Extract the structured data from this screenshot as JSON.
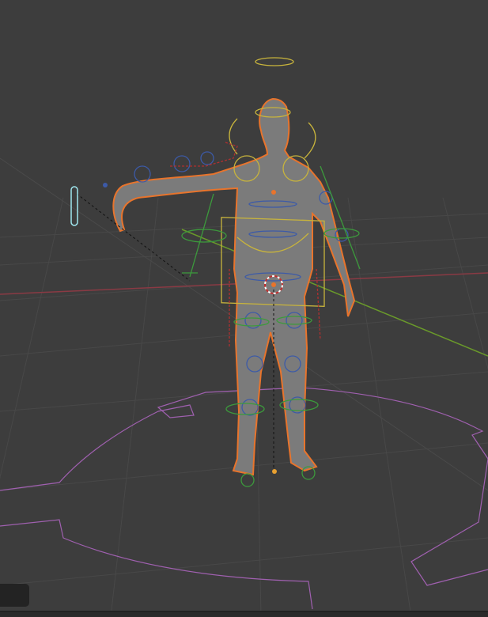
{
  "viewport": {
    "background": "#3d3d3d",
    "grid_color": "#4a4a4a",
    "x_axis_color": "#8a3a44",
    "y_axis_color": "#6a9a2a",
    "mesh_color": "#7b7b7b",
    "selection_outline": "#e8742c",
    "bone_shape_yellow": "#c8b43c",
    "bone_shape_blue": "#3c5aa8",
    "bone_shape_red": "#b03030",
    "bone_shape_green": "#3c9a3c",
    "floor_shape_color": "#a060b0",
    "ik_target_color": "#a0e8f0"
  },
  "operator_panel": {
    "collapsed": true
  }
}
